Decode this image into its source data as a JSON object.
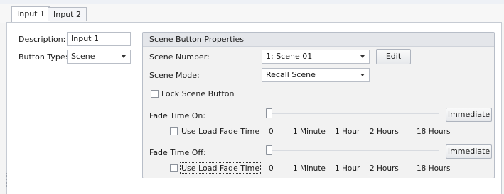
{
  "tabs": [
    {
      "label": "Input 1",
      "active": true
    },
    {
      "label": "Input 2",
      "active": false
    }
  ],
  "left_form": {
    "description_label": "Description:",
    "description_value": "Input 1",
    "button_type_label": "Button Type:",
    "button_type_value": "Scene"
  },
  "scene_props": {
    "title": "Scene Button Properties",
    "scene_number_label": "Scene Number:",
    "scene_number_value": "1: Scene 01",
    "edit_label": "Edit",
    "scene_mode_label": "Scene Mode:",
    "scene_mode_value": "Recall Scene",
    "lock_label": "Lock Scene Button",
    "lock_checked": false
  },
  "fade_on": {
    "label": "Fade Time On:",
    "value_button": "Immediate",
    "use_load_label": "Use Load Fade Time",
    "use_load_checked": false,
    "ticks": [
      "0",
      "1 Minute",
      "1 Hour",
      "2 Hours",
      "18 Hours"
    ],
    "slider_level": 0
  },
  "fade_off": {
    "label": "Fade Time Off:",
    "value_button": "Immediate",
    "use_load_label": "Use Load Fade Time",
    "use_load_checked": false,
    "ticks": [
      "0",
      "1 Minute",
      "1 Hour",
      "2 Hours",
      "18 Hours"
    ],
    "slider_level": 0
  },
  "colors": {
    "panel_bg": "#ffffff",
    "group_bg": "#f2f2f2",
    "group_header_bg": "#e4e6ea",
    "border": "#b8bec8"
  }
}
